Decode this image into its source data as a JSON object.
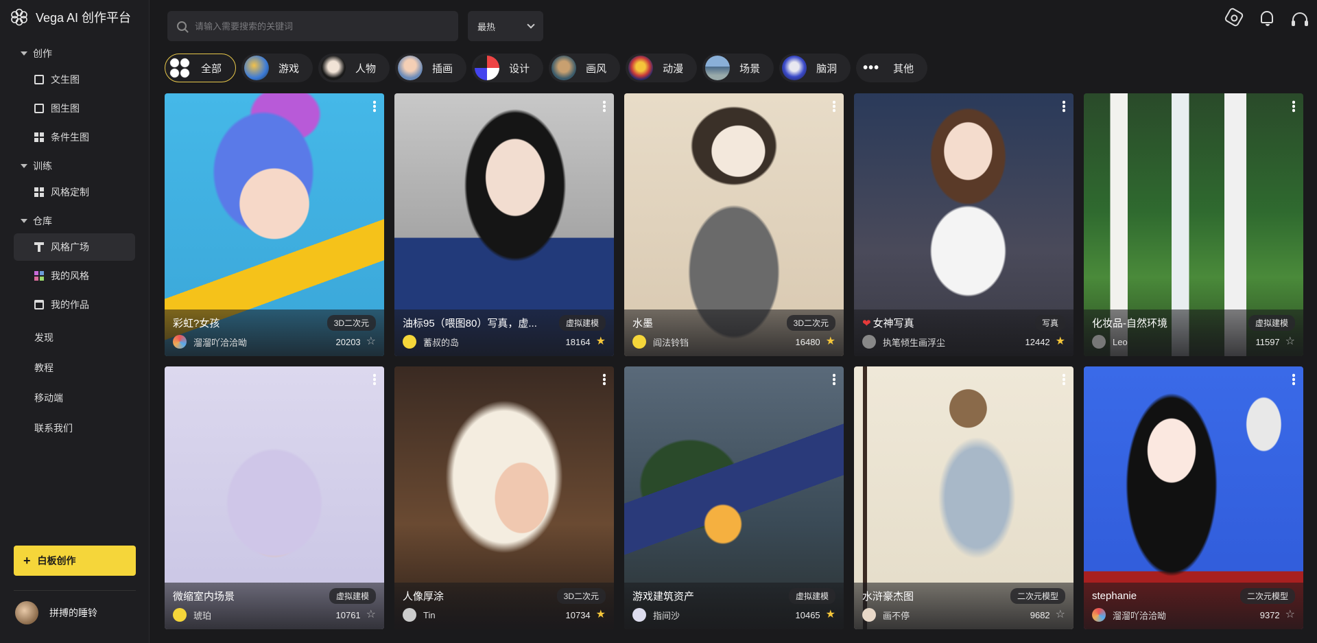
{
  "brand": {
    "name": "Vega AI 创作平台"
  },
  "sidebar": {
    "groups": [
      {
        "label": "创作",
        "items": [
          {
            "label": "文生图"
          },
          {
            "label": "图生图"
          },
          {
            "label": "条件生图"
          }
        ]
      },
      {
        "label": "训练",
        "items": [
          {
            "label": "风格定制"
          }
        ]
      },
      {
        "label": "仓库",
        "items": [
          {
            "label": "风格广场",
            "active": true
          },
          {
            "label": "我的风格"
          },
          {
            "label": "我的作品"
          }
        ]
      }
    ],
    "links": [
      {
        "label": "发现"
      },
      {
        "label": "教程"
      },
      {
        "label": "移动端"
      },
      {
        "label": "联系我们"
      }
    ],
    "whiteboard_label": "白板创作",
    "user_name": "拼搏的睡铃"
  },
  "topbar": {
    "search_placeholder": "请输入需要搜索的关键词",
    "sort_value": "最热"
  },
  "categories": [
    {
      "label": "全部",
      "icon": "all-icon",
      "active": true
    },
    {
      "label": "游戏",
      "icon": "game-thumb"
    },
    {
      "label": "人物",
      "icon": "person-thumb"
    },
    {
      "label": "插画",
      "icon": "illustration-thumb"
    },
    {
      "label": "设计",
      "icon": "design-thumb"
    },
    {
      "label": "画风",
      "icon": "art-style-thumb"
    },
    {
      "label": "动漫",
      "icon": "anime-thumb"
    },
    {
      "label": "场景",
      "icon": "scene-thumb"
    },
    {
      "label": "脑洞",
      "icon": "imagination-thumb"
    },
    {
      "label": "其他",
      "icon": "more-icon"
    }
  ],
  "cards": [
    {
      "title": "彩虹?女孩",
      "tag": "3D二次元",
      "author": "溜溜吖洽洽呦",
      "count": "20203",
      "starred": false,
      "heart": false
    },
    {
      "title": "油标95（喂图80）写真，虚...",
      "tag": "虚拟建模",
      "author": "蓄叔的岛",
      "count": "18164",
      "starred": true,
      "heart": false
    },
    {
      "title": "水墨",
      "tag": "3D二次元",
      "author": "阎法铃铛",
      "count": "16480",
      "starred": true,
      "heart": false
    },
    {
      "title": "女神写真",
      "tag": "写真",
      "author": "执笔倾生画浮尘",
      "count": "12442",
      "starred": true,
      "heart": true
    },
    {
      "title": "化妆品-自然环境",
      "tag": "虚拟建模",
      "author": "Leo",
      "count": "11597",
      "starred": false,
      "heart": false
    },
    {
      "title": "微缩室内场景",
      "tag": "虚拟建模",
      "author": "琥珀",
      "count": "10761",
      "starred": false,
      "heart": false
    },
    {
      "title": "人像厚涂",
      "tag": "3D二次元",
      "author": "Tin",
      "count": "10734",
      "starred": true,
      "heart": false
    },
    {
      "title": "游戏建筑资产",
      "tag": "虚拟建模",
      "author": "指间沙",
      "count": "10465",
      "starred": true,
      "heart": false
    },
    {
      "title": "水浒豪杰图",
      "tag": "二次元模型",
      "author": "画不停",
      "count": "9682",
      "starred": false,
      "heart": false
    },
    {
      "title": "stephanie",
      "tag": "二次元模型",
      "author": "溜溜吖洽洽呦",
      "count": "9372",
      "starred": false,
      "heart": false
    }
  ],
  "colors": {
    "accent": "#f5d63a",
    "star_on": "#f5c63a",
    "background": "#1a1a1c"
  }
}
